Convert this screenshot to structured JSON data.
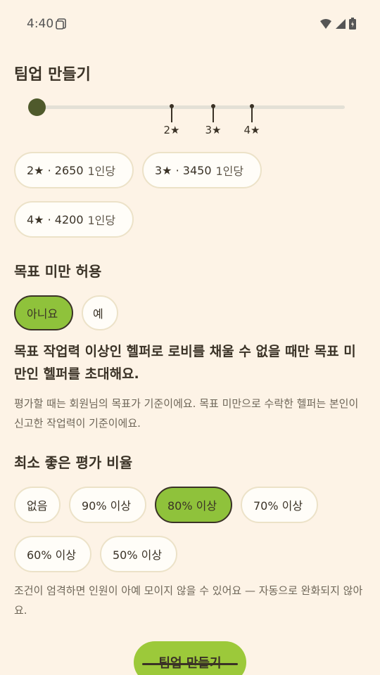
{
  "status": {
    "time": "4:40"
  },
  "title": "팀업 만들기",
  "slider": {
    "ticks": [
      "2★",
      "3★",
      "4★"
    ],
    "value_position": 0
  },
  "star_chips": [
    {
      "label": "2★ · 2650",
      "sub": "1인당"
    },
    {
      "label": "3★ · 3450",
      "sub": "1인당"
    },
    {
      "label": "4★ · 4200",
      "sub": "1인당"
    }
  ],
  "below_target": {
    "title": "목표 미만 허용",
    "options": [
      "아니요",
      "예"
    ],
    "selected": "아니요",
    "headline": "목표 작업력 이상인 헬퍼로 로비를 채울 수 없을 때만 목표 미만인 헬퍼를 초대해요.",
    "description": "평가할 때는 회원님의 목표가 기준이에요. 목표 미만으로 수락한 헬퍼는 본인이 신고한 작업력이 기준이에요."
  },
  "rating": {
    "title": "최소 좋은 평가 비율",
    "options": [
      "없음",
      "90% 이상",
      "80% 이상",
      "70% 이상",
      "60% 이상",
      "50% 이상"
    ],
    "selected": "80% 이상",
    "note": "조건이 엄격하면 인원이 아예 모이지 않을 수 있어요 — 자동으로 완화되지 않아요."
  },
  "cta": {
    "label": "팀업 만들기"
  },
  "colors": {
    "background": "#fdf3e6",
    "accent": "#8fc23b",
    "thumb": "#4f5a2c"
  }
}
